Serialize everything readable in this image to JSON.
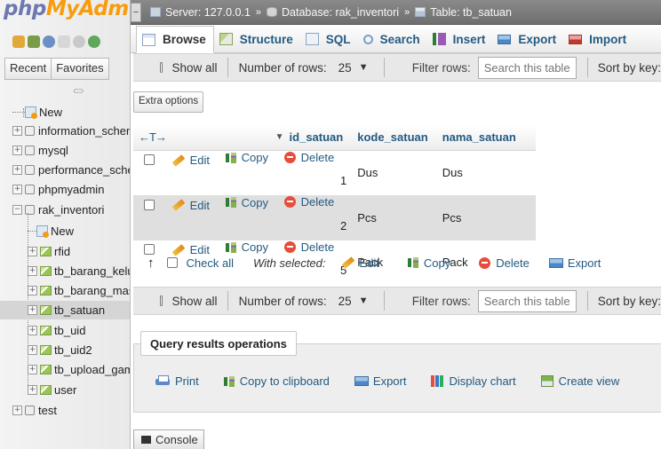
{
  "logo": {
    "php": "php",
    "my": "MyAdm"
  },
  "nav": {
    "tabs": [
      "Recent",
      "Favorites"
    ],
    "tree": [
      {
        "label": "New",
        "kind": "new"
      },
      {
        "label": "information_schema",
        "kind": "db",
        "state": "+"
      },
      {
        "label": "mysql",
        "kind": "db",
        "state": "+"
      },
      {
        "label": "performance_schema",
        "kind": "db",
        "state": "+"
      },
      {
        "label": "phpmyadmin",
        "kind": "db",
        "state": "+"
      },
      {
        "label": "rak_inventori",
        "kind": "db",
        "state": "−"
      }
    ],
    "subtree": [
      {
        "label": "New",
        "kind": "new"
      },
      {
        "label": "rfid"
      },
      {
        "label": "tb_barang_keluar"
      },
      {
        "label": "tb_barang_masuk"
      },
      {
        "label": "tb_satuan",
        "selected": true
      },
      {
        "label": "tb_uid"
      },
      {
        "label": "tb_uid2"
      },
      {
        "label": "tb_upload_gambar"
      },
      {
        "label": "user"
      }
    ],
    "last": {
      "label": "test",
      "state": "+"
    }
  },
  "breadcrumb": {
    "server": "Server: 127.0.0.1",
    "database": "Database: rak_inventori",
    "table": "Table: tb_satuan"
  },
  "tabs": [
    "Browse",
    "Structure",
    "SQL",
    "Search",
    "Insert",
    "Export",
    "Import"
  ],
  "navbar": {
    "show_all": "Show all",
    "rows_label": "Number of rows:",
    "rows_value": "25",
    "filter_label": "Filter rows:",
    "search_placeholder": "Search this table",
    "sort_label": "Sort by key:"
  },
  "extra_options": "Extra options",
  "table": {
    "header_arrows": "←T→",
    "columns": [
      "id_satuan",
      "kode_satuan",
      "nama_satuan"
    ],
    "actions": {
      "edit": "Edit",
      "copy": "Copy",
      "delete": "Delete"
    },
    "rows": [
      [
        "1",
        "Dus",
        "Dus"
      ],
      [
        "2",
        "Pcs",
        "Pcs"
      ],
      [
        "5",
        "Pack",
        "Pack"
      ]
    ]
  },
  "bulk": {
    "check_all": "Check all",
    "with_selected": "With selected:",
    "edit": "Edit",
    "copy": "Copy",
    "delete": "Delete",
    "export": "Export"
  },
  "query_ops": {
    "legend": "Query results operations",
    "print": "Print",
    "copy_clipboard": "Copy to clipboard",
    "export": "Export",
    "display_chart": "Display chart",
    "create_view": "Create view"
  },
  "console": "Console"
}
